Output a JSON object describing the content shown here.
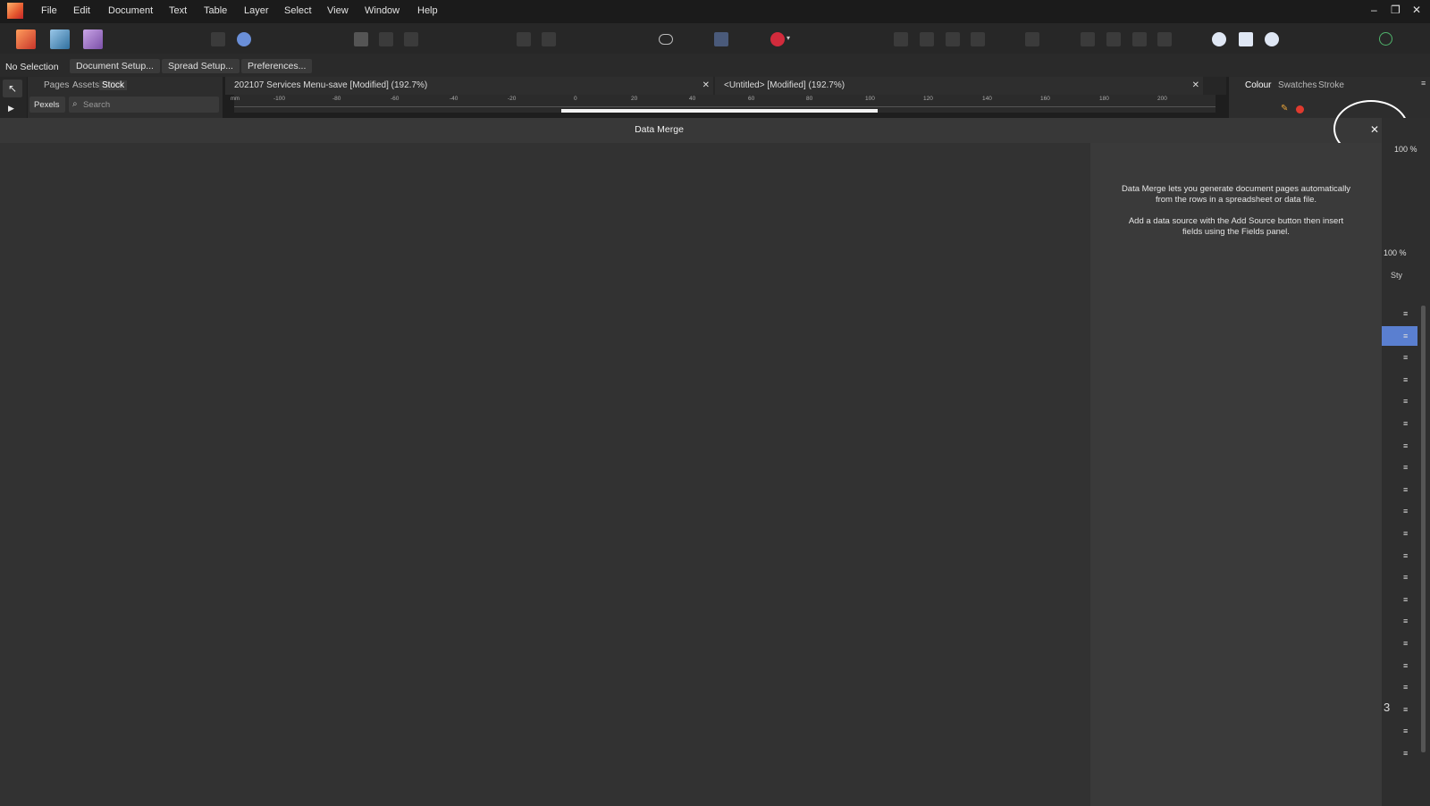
{
  "menu": {
    "items": [
      "File",
      "Edit",
      "Document",
      "Text",
      "Table",
      "Layer",
      "Select",
      "View",
      "Window",
      "Help"
    ]
  },
  "window_controls": {
    "minimize": "–",
    "restore": "❐",
    "close": "✕"
  },
  "context_bar": {
    "selection": "No Selection",
    "buttons": [
      "Document Setup...",
      "Spread Setup...",
      "Preferences..."
    ]
  },
  "left_panel": {
    "tabs": [
      "Pages",
      "Assets",
      "Stock"
    ],
    "units": "Pexels",
    "search_placeholder": "Search"
  },
  "document_tabs": [
    {
      "title": "202107 Services Menu-save [Modified] (192.7%)",
      "close": "✕"
    },
    {
      "title": "<Untitled> [Modified] (192.7%)",
      "close": "✕"
    }
  ],
  "ruler": {
    "unit": "mm",
    "ticks": [
      "-100",
      "-80",
      "-60",
      "-40",
      "-20",
      "0",
      "20",
      "40",
      "60",
      "80",
      "100",
      "120",
      "140",
      "160",
      "180",
      "200"
    ]
  },
  "right_panel": {
    "tabs": [
      "Colour",
      "Swatches",
      "Stroke"
    ],
    "opacity": "100 %",
    "zoom": "100 %",
    "styles_tab": "Sty",
    "number": "3"
  },
  "modal": {
    "title": "Data Merge",
    "close": "✕",
    "description_1": "Data Merge lets you generate document pages automatically from the rows in a spreadsheet or data file.",
    "description_2": "Add a data source with the Add Source button then insert fields using the Fields panel."
  }
}
